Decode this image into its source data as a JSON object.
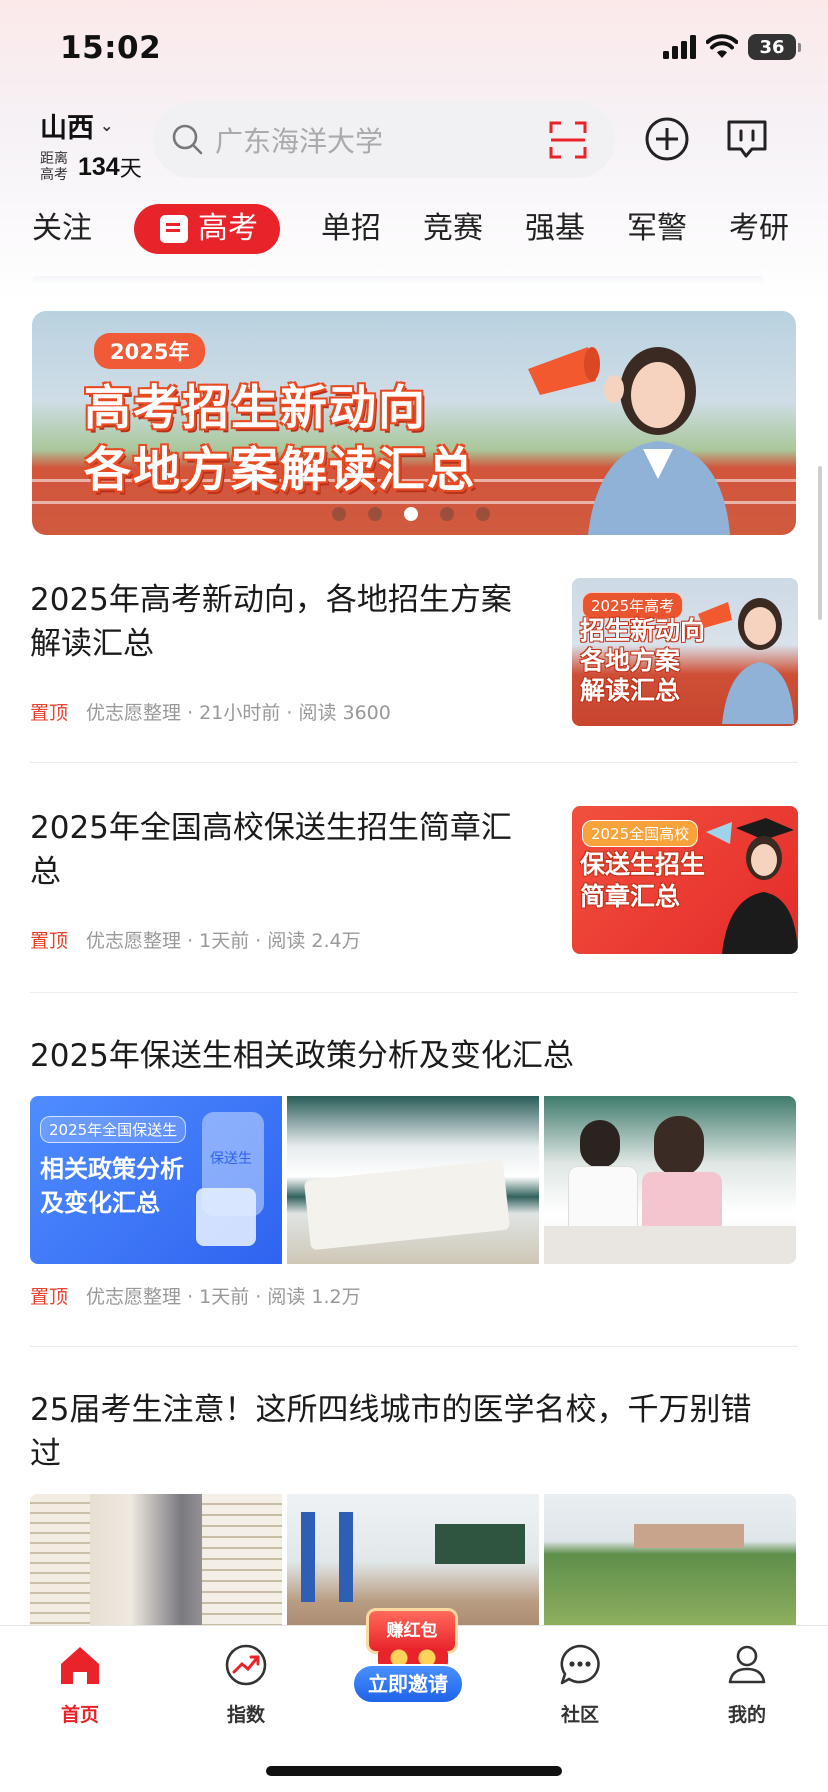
{
  "status": {
    "time": "15:02",
    "battery": "36"
  },
  "header": {
    "region": "山西",
    "countdown_label": "距离高考",
    "countdown_days": "134",
    "countdown_unit": "天",
    "search_placeholder": "广东海洋大学"
  },
  "tabs": [
    "关注",
    "高考",
    "单招",
    "竞赛",
    "强基",
    "军警",
    "考研"
  ],
  "active_tab": "高考",
  "banner": {
    "tag": "2025年",
    "line1": "高考招生新动向",
    "line2": "各地方案解读汇总",
    "dots": 5,
    "active_dot": 3
  },
  "feed": [
    {
      "title": "2025年高考新动向，各地招生方案解读汇总",
      "pin": "置顶",
      "source": "优志愿整理",
      "time": "21小时前",
      "reads": "阅读 3600",
      "thumb_tag": "2025年高考",
      "thumb_text": [
        "招生新动向",
        "各地方案",
        "解读汇总"
      ]
    },
    {
      "title": "2025年全国高校保送生招生简章汇总",
      "pin": "置顶",
      "source": "优志愿整理",
      "time": "1天前",
      "reads": "阅读 2.4万",
      "thumb_tag": "2025全国高校",
      "thumb_text": [
        "保送生招生",
        "简章汇总"
      ]
    },
    {
      "title": "2025年保送生相关政策分析及变化汇总",
      "pin": "置顶",
      "source": "优志愿整理",
      "time": "1天前",
      "reads": "阅读 1.2万",
      "thumb_tag": "2025年全国保送生",
      "thumb_text": [
        "相关政策分析",
        "及变化汇总"
      ],
      "thumb_mini": "保送生"
    },
    {
      "title": "25届考生注意！这所四线城市的医学名校，千万别错过"
    }
  ],
  "nav": {
    "home": "首页",
    "index": "指数",
    "invite_top": "赚红包",
    "invite_btn": "立即邀请",
    "community": "社区",
    "mine": "我的"
  },
  "colors": {
    "accent": "#e8232a",
    "pin": "#e8412c",
    "invite_blue": "#1f63e8"
  }
}
